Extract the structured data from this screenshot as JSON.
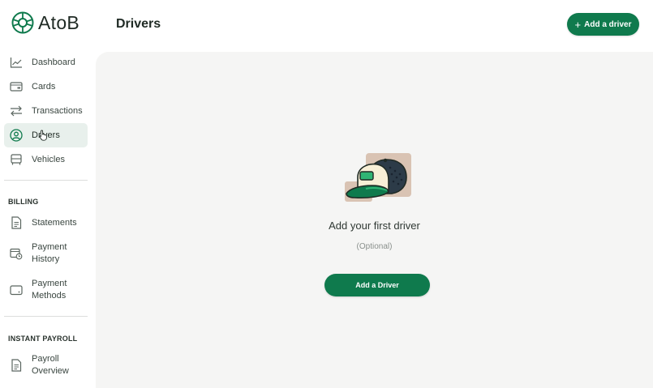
{
  "brand": {
    "name": "AtoB",
    "color": "#0f7a4d"
  },
  "header": {
    "title": "Drivers",
    "add_button": {
      "icon": "plus-icon",
      "label": "Add a driver"
    }
  },
  "sidebar": {
    "items": [
      {
        "label": "Dashboard",
        "icon": "chart-line-icon"
      },
      {
        "label": "Cards",
        "icon": "card-icon"
      },
      {
        "label": "Transactions",
        "icon": "swap-arrows-icon"
      },
      {
        "label": "Drivers",
        "icon": "user-circle-icon",
        "active": true
      },
      {
        "label": "Vehicles",
        "icon": "truck-icon"
      }
    ],
    "billing": {
      "heading": "BILLING",
      "items": [
        {
          "label": "Statements",
          "icon": "document-icon"
        },
        {
          "line1": "Payment",
          "line2": "History",
          "icon": "calendar-clock-icon"
        },
        {
          "line1": "Payment",
          "line2": "Methods",
          "icon": "wallet-icon"
        }
      ]
    },
    "payroll": {
      "heading": "INSTANT PAYROLL",
      "items": [
        {
          "line1": "Payroll",
          "line2": "Overview",
          "icon": "document-icon"
        }
      ]
    }
  },
  "empty_state": {
    "illustration": "cap-illustration",
    "title": "Add your first driver",
    "subtitle": "(Optional)",
    "button_label": "Add a Driver"
  }
}
